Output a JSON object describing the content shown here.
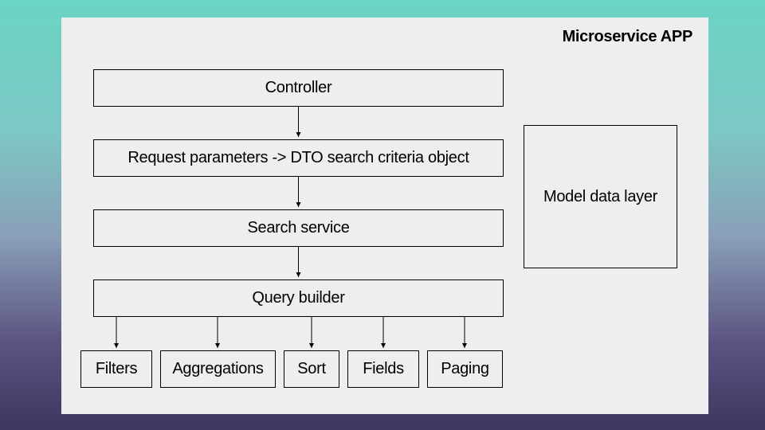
{
  "title": "Microservice APP",
  "flow": {
    "controller": "Controller",
    "dto": "Request parameters -> DTO search criteria object",
    "service": "Search service",
    "builder": "Query builder"
  },
  "leaves": {
    "filters": "Filters",
    "aggregations": "Aggregations",
    "sort": "Sort",
    "fields": "Fields",
    "paging": "Paging"
  },
  "side": "Model data layer"
}
